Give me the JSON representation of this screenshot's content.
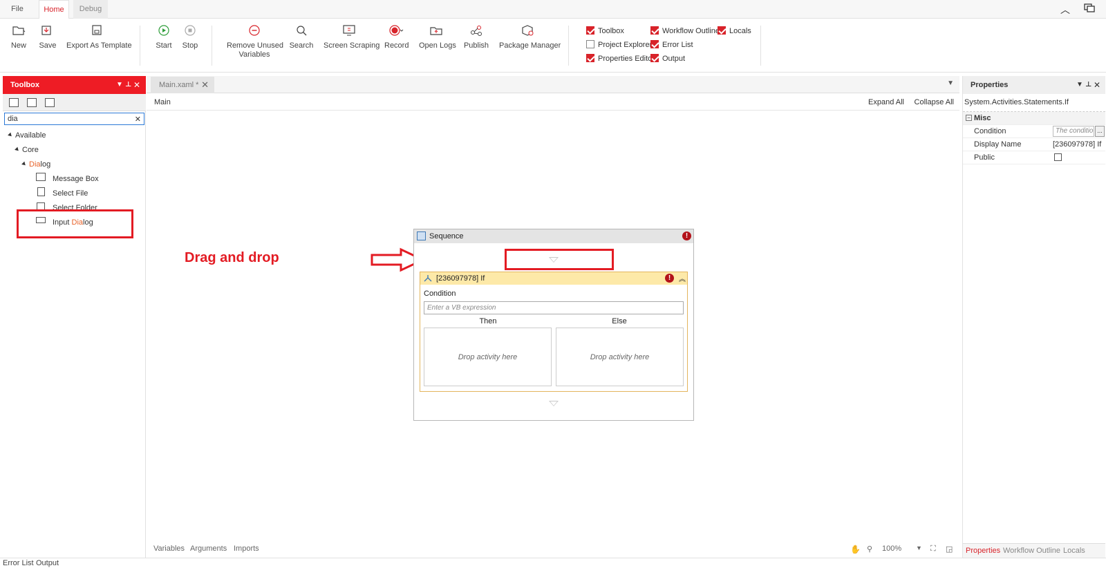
{
  "menu": {
    "tabs": [
      "File",
      "Home",
      "Debug"
    ],
    "active_tab": "Home"
  },
  "ribbon": {
    "buttons": [
      {
        "label": "New",
        "icon": "new-file-icon"
      },
      {
        "label": "Save",
        "icon": "save-icon"
      },
      {
        "label": "Export As Template",
        "icon": "export-template-icon"
      },
      {
        "label": "Start",
        "icon": "play-icon"
      },
      {
        "label": "Stop",
        "icon": "stop-icon"
      },
      {
        "label": "Remove Unused Variables",
        "icon": "remove-icon"
      },
      {
        "label": "Search",
        "icon": "search-icon"
      },
      {
        "label": "Screen Scraping",
        "icon": "screen-scraping-icon"
      },
      {
        "label": "Record",
        "icon": "record-icon"
      },
      {
        "label": "Open Logs",
        "icon": "open-logs-icon"
      },
      {
        "label": "Publish",
        "icon": "publish-icon"
      },
      {
        "label": "Package Manager",
        "icon": "package-manager-icon"
      }
    ],
    "remove_unused_line1": "Remove Unused",
    "remove_unused_line2": "Variables",
    "panels": [
      {
        "label": "Toolbox",
        "checked": true
      },
      {
        "label": "Workflow Outline",
        "checked": true
      },
      {
        "label": "Locals",
        "checked": true
      },
      {
        "label": "Project Explorer",
        "checked": false
      },
      {
        "label": "Error List",
        "checked": true
      },
      {
        "label": "Properties Editor",
        "checked": true
      },
      {
        "label": "Output",
        "checked": true
      }
    ]
  },
  "toolbox": {
    "title": "Toolbox",
    "search_value": "dia",
    "tree": {
      "available": "Available",
      "core": "Core",
      "dialog_hl": "Dia",
      "dialog_rest": "log",
      "items": [
        "Message Box",
        "Select File",
        "Select Folder"
      ],
      "input_dialog_prefix": "Input ",
      "input_dialog_hl": "Dia",
      "input_dialog_rest": "log"
    }
  },
  "document": {
    "tab_label": "Main.xaml *",
    "breadcrumb": "Main",
    "expand_all": "Expand All",
    "collapse_all": "Collapse All",
    "annotation": "Drag and drop",
    "sequence_title": "Sequence",
    "if_title": "[236097978] If",
    "condition_label": "Condition",
    "condition_placeholder": "Enter a VB expression",
    "then_label": "Then",
    "else_label": "Else",
    "drop_hint": "Drop activity here",
    "footer": {
      "variables": "Variables",
      "arguments": "Arguments",
      "imports": "Imports",
      "zoom": "100%"
    }
  },
  "properties": {
    "title": "Properties",
    "type": "System.Activities.Statements.If",
    "category": "Misc",
    "rows": [
      {
        "name": "Condition",
        "value": "The conditio"
      },
      {
        "name": "Display Name",
        "value": "[236097978] If"
      },
      {
        "name": "Public",
        "value": ""
      }
    ],
    "ellipsis": "...",
    "footer_tabs": [
      "Properties",
      "Workflow Outline",
      "Locals"
    ]
  },
  "bottom": {
    "tabs": [
      "Error List",
      "Output"
    ]
  },
  "colors": {
    "accent": "#d8232a",
    "toolbox_header": "#ee1c25",
    "annotation": "#e31b23",
    "if_header": "#fde9a8"
  }
}
